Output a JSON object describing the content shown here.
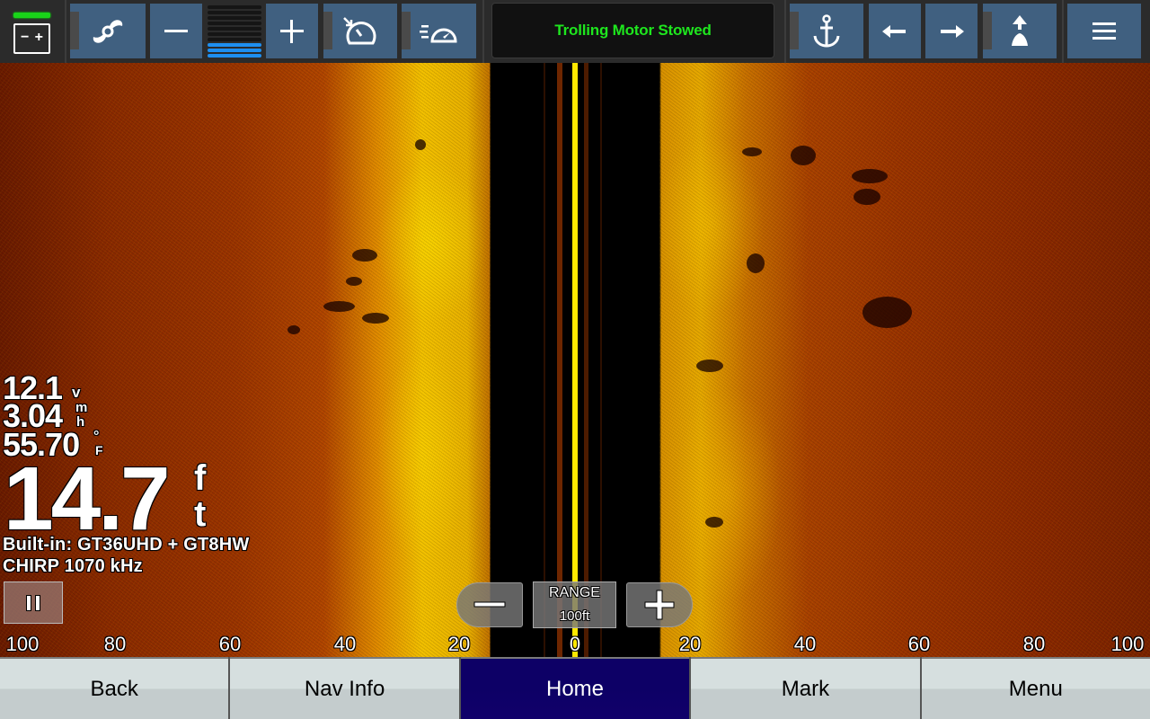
{
  "top_toolbar": {
    "battery": {
      "icon": "battery-icon",
      "minus": "−",
      "plus": "+",
      "status_color": "#19d419"
    },
    "buttons": [
      {
        "id": "trolling-motor",
        "icon": "propeller-icon"
      },
      {
        "id": "gain-decrease",
        "icon": "minus-icon"
      },
      {
        "id": "gain-increase",
        "icon": "plus-icon"
      },
      {
        "id": "cruise-control",
        "icon": "speedometer-set-icon"
      },
      {
        "id": "speed-mode",
        "icon": "speedometer-fast-icon"
      },
      {
        "id": "anchor-lock",
        "icon": "anchor-icon"
      },
      {
        "id": "jog-left",
        "icon": "arrow-left-icon"
      },
      {
        "id": "jog-right",
        "icon": "arrow-right-icon"
      },
      {
        "id": "heading-hold",
        "icon": "heading-hold-icon"
      },
      {
        "id": "menu",
        "icon": "hamburger-menu-icon"
      }
    ],
    "gain_meter": {
      "level": 3,
      "max": 10,
      "active_color": "#1e8ff0"
    },
    "status_message": "Trolling Motor Stowed",
    "status_color": "#1ee61e",
    "button_color": "#406080"
  },
  "sonar": {
    "mode": "SideVü",
    "voltage": {
      "value": "12.1",
      "unit": "v"
    },
    "speed": {
      "value": "3.04",
      "unit_top": "m",
      "unit_bottom": "h"
    },
    "water_temp": {
      "value": "55.70",
      "unit_top": "°",
      "unit_bottom": "F"
    },
    "depth": {
      "value": "14.7",
      "unit_top": "f",
      "unit_bottom": "t"
    },
    "transducer_source": "Built-in: GT36UHD + GT8HW",
    "frequency": "CHIRP 1070 kHz",
    "pause_icon": "pause-icon",
    "range": {
      "label": "RANGE",
      "value": "100ft",
      "minus": "−",
      "plus": "+"
    },
    "scale_labels": [
      "100",
      "80",
      "60",
      "40",
      "20",
      "0",
      "20",
      "40",
      "60",
      "80",
      "100"
    ],
    "centerline_color": "#ffe800"
  },
  "softkeys": [
    {
      "label": "Back",
      "active": false
    },
    {
      "label": "Nav Info",
      "active": false
    },
    {
      "label": "Home",
      "active": true
    },
    {
      "label": "Mark",
      "active": false
    },
    {
      "label": "Menu",
      "active": false
    }
  ]
}
